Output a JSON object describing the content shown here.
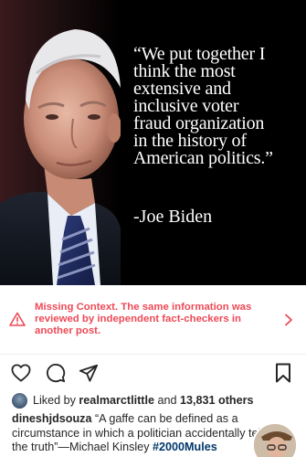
{
  "post": {
    "quote": "“We put together I\nthink the most\nextensive and\ninclusive voter\nfraud organization\nin the history of\nAmerican politics.”",
    "attribution": "-Joe Biden"
  },
  "context_notice": {
    "text": "Missing Context. The same information was reviewed by independent fact-checkers in another post.",
    "color": "#ed4956",
    "icon": "warning-triangle-icon"
  },
  "actions": {
    "icons": [
      "heart-icon",
      "comment-icon",
      "share-icon",
      "bookmark-icon"
    ]
  },
  "likes": {
    "prefix": "Liked by ",
    "user": "realmarctlittle",
    "joiner": " and ",
    "count": "13,831 others"
  },
  "caption": {
    "username": "dineshjdsouza",
    "text": " “A gaffe can be defined as a circumstance in which a politician accidentally tells the truth”—Michael Kinsley ",
    "hashtag": "#2000Mules"
  }
}
